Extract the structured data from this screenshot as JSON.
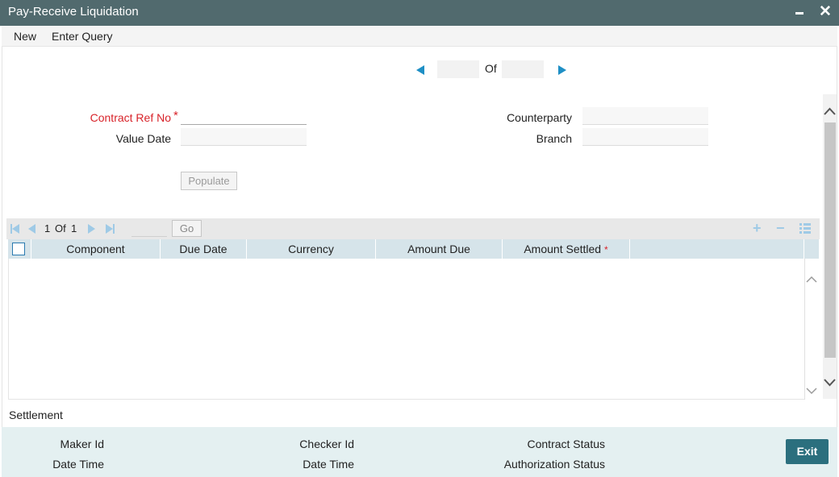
{
  "window": {
    "title": "Pay-Receive Liquidation",
    "close_glyph": "✕"
  },
  "menu": {
    "new_label": "New",
    "enter_query_label": "Enter Query"
  },
  "record_nav": {
    "of_label": "Of",
    "current": "",
    "total": ""
  },
  "form": {
    "contract_ref_label": "Contract Ref No",
    "contract_ref_required": "*",
    "contract_ref_value": "",
    "value_date_label": "Value Date",
    "value_date_value": "",
    "counterparty_label": "Counterparty",
    "counterparty_value": "",
    "branch_label": "Branch",
    "branch_value": "",
    "populate_label": "Populate"
  },
  "grid": {
    "page_current": "1",
    "page_of": "Of",
    "page_total": "1",
    "go_label": "Go",
    "columns": [
      "Component",
      "Due Date",
      "Currency",
      "Amount Due",
      "Amount Settled"
    ],
    "amount_settled_required": "*",
    "rows": []
  },
  "settlement_label": "Settlement",
  "footer": {
    "maker_id_label": "Maker Id",
    "maker_date_time_label": "Date Time",
    "checker_id_label": "Checker Id",
    "checker_date_time_label": "Date Time",
    "contract_status_label": "Contract Status",
    "authorization_status_label": "Authorization Status",
    "exit_label": "Exit"
  },
  "colors": {
    "titlebar": "#516a6e",
    "accent_blue": "#1e8fc5",
    "required_red": "#d8232a",
    "footer_bg": "#e4f0f1",
    "exit_button": "#2b6f7e",
    "grid_header": "#d6e4ea"
  }
}
